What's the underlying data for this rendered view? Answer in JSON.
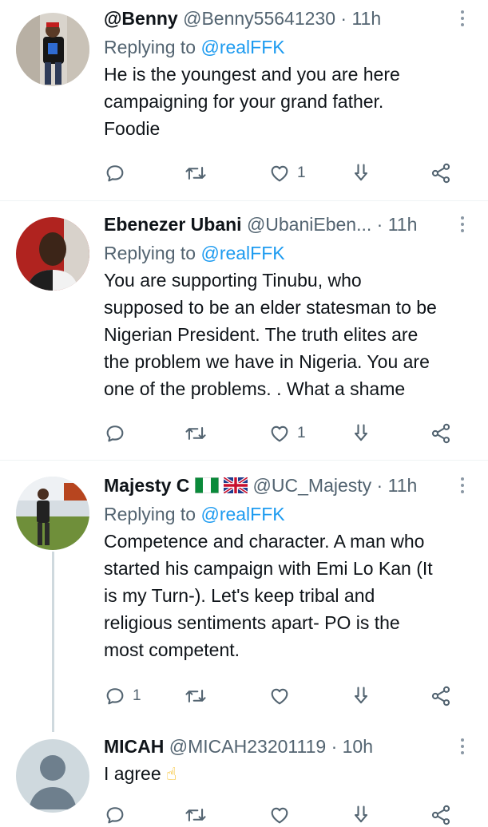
{
  "replying_label": "Replying to",
  "replies": [
    {
      "name": "@Benny",
      "handle": "@Benny55641230",
      "separator": "·",
      "time": "11h",
      "replying_to": "@realFFK",
      "text_lines": [
        "He is the youngest and you are here",
        "campaigning for your grand father.",
        "Foodie"
      ],
      "counts": {
        "reply": "",
        "retweet": "",
        "like": "1"
      }
    },
    {
      "name": "Ebenezer Ubani",
      "handle": "@UbaniEben...",
      "separator": "·",
      "time": "11h",
      "replying_to": "@realFFK",
      "text_lines": [
        "You are supporting Tinubu, who",
        "supposed to be an elder statesman to be",
        "Nigerian President. The truth elites are",
        "the problem we have in Nigeria. You are",
        "one of the problems. . What a shame"
      ],
      "counts": {
        "reply": "",
        "retweet": "",
        "like": "1"
      }
    },
    {
      "name": "Majesty C",
      "handle": "@UC_Majesty",
      "separator": "·",
      "time": "11h",
      "replying_to": "@realFFK",
      "text_lines": [
        "Competence and character. A man who",
        "started his campaign with Emi Lo Kan (It",
        "is my Turn-). Let's keep tribal and",
        "religious sentiments apart- PO is the",
        "most competent."
      ],
      "counts": {
        "reply": "1",
        "retweet": "",
        "like": ""
      }
    },
    {
      "name": "MICAH",
      "handle": "@MICAH23201119",
      "separator": "·",
      "time": "10h",
      "text": "I agree",
      "emoji": "☝"
    }
  ],
  "colors": {
    "accent": "#1d9bf0",
    "secondary_text": "#536471",
    "divider": "#eff3f4"
  },
  "icons": [
    "reply-icon",
    "retweet-icon",
    "like-icon",
    "bookmark-icon",
    "share-icon",
    "more-icon"
  ]
}
